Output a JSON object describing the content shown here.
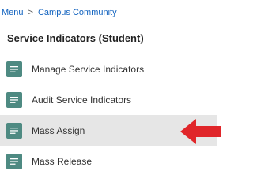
{
  "breadcrumb": {
    "menu_label": "Menu",
    "separator": ">",
    "current_label": "Campus Community"
  },
  "section": {
    "title": "Service Indicators (Student)"
  },
  "menu_items": [
    {
      "label": "Manage Service Indicators",
      "icon": "list-icon"
    },
    {
      "label": "Audit Service Indicators",
      "icon": "list-icon"
    },
    {
      "label": "Mass Assign",
      "icon": "list-icon",
      "selected": true
    },
    {
      "label": "Mass Release",
      "icon": "list-icon"
    }
  ],
  "colors": {
    "link": "#1565c0",
    "icon_background": "#4e8a82",
    "selected_background": "#e6e6e6",
    "arrow": "#e0262a"
  }
}
